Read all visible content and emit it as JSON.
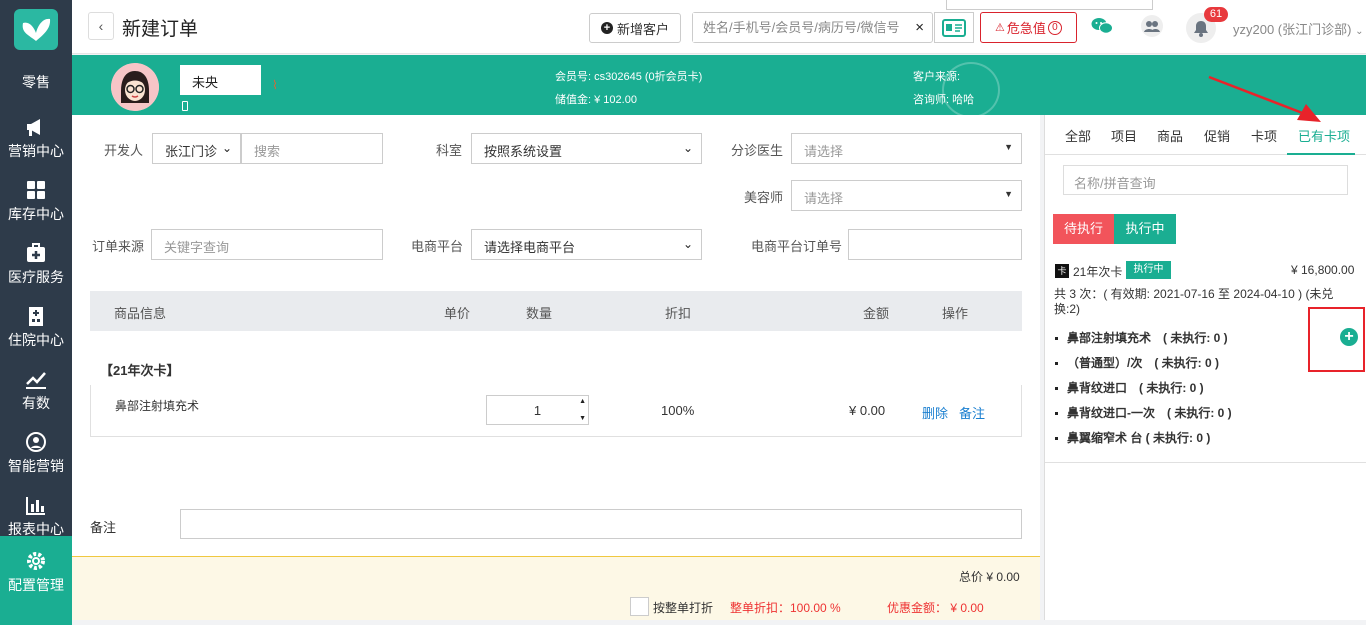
{
  "sidebar": {
    "retail": "零售",
    "items": [
      {
        "label": "营销中心",
        "icon": "megaphone-icon"
      },
      {
        "label": "库存中心",
        "icon": "grid-icon"
      },
      {
        "label": "医疗服务",
        "icon": "medical-kit-icon"
      },
      {
        "label": "住院中心",
        "icon": "hospital-icon"
      },
      {
        "label": "有数",
        "icon": "line-chart-icon"
      },
      {
        "label": "智能营销",
        "icon": "smart-marketing-icon"
      },
      {
        "label": "报表中心",
        "icon": "bar-chart-icon"
      },
      {
        "label": "配置管理",
        "icon": "gear-icon"
      }
    ],
    "active_index": 7
  },
  "header": {
    "back_icon": "‹",
    "title": "新建订单",
    "new_customer": "新增客户",
    "search_placeholder": "姓名/手机号/会员号/病历号/微信号",
    "clear_icon": "×",
    "danger_label": "危急值",
    "danger_count": "0",
    "notif_count": "61",
    "user": "yzy200 (张江门诊部)"
  },
  "customer": {
    "name": "未央",
    "member_no_label": "会员号:",
    "member_no": "cs302645 (0折会员卡)",
    "balance_label": "储值金:",
    "balance": "¥ 102.00",
    "source_label": "客户来源:",
    "source": "",
    "consultant_label": "咨询师:",
    "consultant": "哈哈"
  },
  "form": {
    "developer_label": "开发人",
    "developer_value": "张江门诊",
    "developer_search": "搜索",
    "dept_label": "科室",
    "dept_value": "按照系统设置",
    "triage_label": "分诊医生",
    "triage_placeholder": "请选择",
    "beautician_label": "美容师",
    "beautician_placeholder": "请选择",
    "source_label": "订单来源",
    "source_placeholder": "关键字查询",
    "ecom_label": "电商平台",
    "ecom_value": "请选择电商平台",
    "ecom_order_label": "电商平台订单号",
    "ecom_order_value": ""
  },
  "table": {
    "headers": [
      "商品信息",
      "单价",
      "数量",
      "折扣",
      "金额",
      "操作"
    ],
    "group": "【21年次卡】",
    "rows": [
      {
        "name": "鼻部注射填充术",
        "qty": "1",
        "discount": "100%",
        "amount": "¥ 0.00",
        "delete": "删除",
        "note": "备注"
      }
    ]
  },
  "remark_label": "备注",
  "footer": {
    "total": "总价 ¥  0.00",
    "whole_discount_check": "按整单打折",
    "whole_discount": "整单折扣：100.00 %",
    "discount_amount": "优惠金额： ¥  0.00"
  },
  "right_panel": {
    "tabs": [
      "全部",
      "项目",
      "商品",
      "促销",
      "卡项",
      "已有卡项"
    ],
    "active_tab": 5,
    "search_placeholder": "名称/拼音查询",
    "btn_pending": "待执行",
    "btn_executing": "执行中",
    "card": {
      "icon": "卡",
      "name": "21年次卡",
      "status": "执行中",
      "price": "¥ 16,800.00",
      "info": "共 3 次：( 有效期: 2021-07-16 至 2024-04-10 ) (未兑换:2)",
      "items": [
        "鼻部注射填充术　( 未执行: 0 )",
        "（普通型）/次　( 未执行: 0 )",
        "鼻背纹进口　( 未执行: 0 )",
        "鼻背纹进口-一次　( 未执行: 0 )",
        "鼻翼缩窄术 台 ( 未执行: 0 )"
      ]
    },
    "add_icon": "+"
  },
  "colors": {
    "primary": "#1aae92",
    "sidebar": "#2e3b4a",
    "danger": "#d9232d",
    "annotation": "#e8232a"
  }
}
